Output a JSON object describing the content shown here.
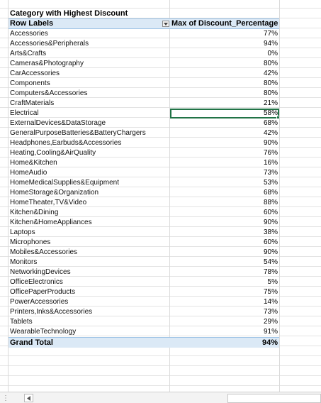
{
  "pivot": {
    "title": "Category with Highest Discount",
    "header": {
      "row_labels": "Row Labels",
      "value_header": "Max of Discount_Percentage"
    },
    "rows": [
      {
        "label": "Accessories",
        "value": "77%"
      },
      {
        "label": "Accessories&Peripherals",
        "value": "94%"
      },
      {
        "label": "Arts&Crafts",
        "value": "0%"
      },
      {
        "label": "Cameras&Photography",
        "value": "80%"
      },
      {
        "label": "CarAccessories",
        "value": "42%"
      },
      {
        "label": "Components",
        "value": "80%"
      },
      {
        "label": "Computers&Accessories",
        "value": "80%"
      },
      {
        "label": "CraftMaterials",
        "value": "21%"
      },
      {
        "label": "Electrical",
        "value": "58%"
      },
      {
        "label": "ExternalDevices&DataStorage",
        "value": "68%"
      },
      {
        "label": "GeneralPurposeBatteries&BatteryChargers",
        "value": "42%"
      },
      {
        "label": "Headphones,Earbuds&Accessories",
        "value": "90%"
      },
      {
        "label": "Heating,Cooling&AirQuality",
        "value": "76%"
      },
      {
        "label": "Home&Kitchen",
        "value": "16%"
      },
      {
        "label": "HomeAudio",
        "value": "73%"
      },
      {
        "label": "HomeMedicalSupplies&Equipment",
        "value": "53%"
      },
      {
        "label": "HomeStorage&Organization",
        "value": "68%"
      },
      {
        "label": "HomeTheater,TV&Video",
        "value": "88%"
      },
      {
        "label": "Kitchen&Dining",
        "value": "60%"
      },
      {
        "label": "Kitchen&HomeAppliances",
        "value": "90%"
      },
      {
        "label": "Laptops",
        "value": "38%"
      },
      {
        "label": "Microphones",
        "value": "60%"
      },
      {
        "label": "Mobiles&Accessories",
        "value": "90%"
      },
      {
        "label": "Monitors",
        "value": "54%"
      },
      {
        "label": "NetworkingDevices",
        "value": "78%"
      },
      {
        "label": "OfficeElectronics",
        "value": "5%"
      },
      {
        "label": "OfficePaperProducts",
        "value": "75%"
      },
      {
        "label": "PowerAccessories",
        "value": "14%"
      },
      {
        "label": "Printers,Inks&Accessories",
        "value": "73%"
      },
      {
        "label": "Tablets",
        "value": "29%"
      },
      {
        "label": "WearableTechnology",
        "value": "91%"
      }
    ],
    "selected_row_index": 8,
    "grand_total": {
      "label": "Grand Total",
      "value": "94%"
    }
  },
  "colors": {
    "header_fill": "#dbe9f6",
    "header_border": "#9cc2e5",
    "selection": "#217346",
    "gridline": "#e3e3e3"
  },
  "icons": {
    "filter": "filter-dropdown-icon",
    "sheet_nav": "caret-left-icon",
    "more": "vertical-dots-icon"
  }
}
